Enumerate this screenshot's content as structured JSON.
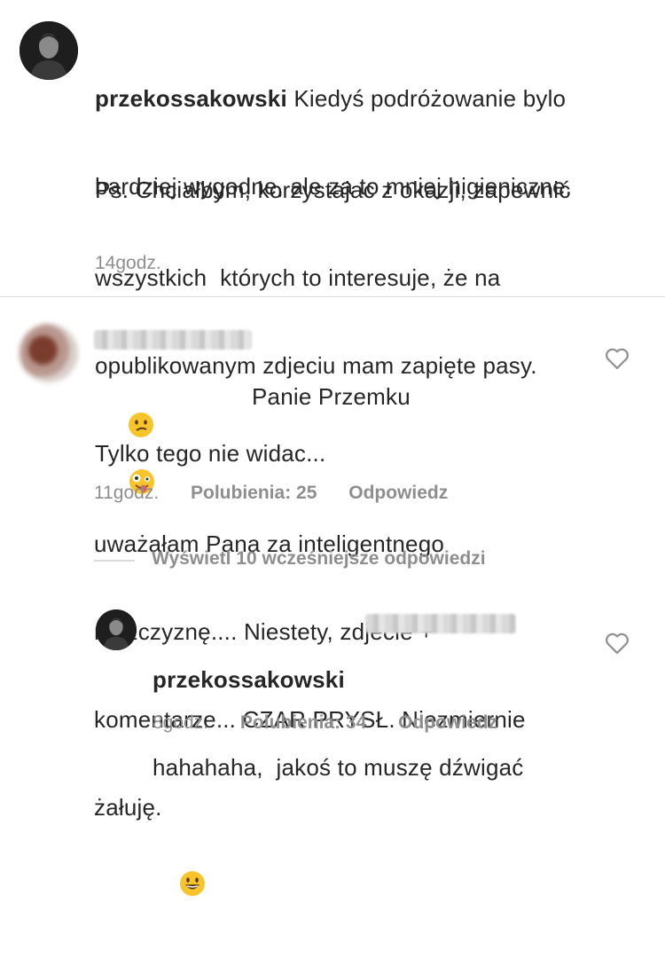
{
  "post": {
    "username": "przekossakowski",
    "caption_line1": "Kiedyś podróżowanie bylo",
    "caption_line2": "bardziej wygodne, ale za to mniej higieniczne.",
    "caption_ps_1": "Ps. Chciałbym, korzystajac z okazji, zapewnić",
    "caption_ps_2": "wszystkich  których to interesuje, że na",
    "caption_ps_3": "opublikowanym zdjeciu mam zapięte pasy.",
    "caption_ps_4": "Tylko tego nie widac...",
    "emoji": "zany-face-emoji",
    "time": "14godz."
  },
  "comment": {
    "line1": "Panie Przemku",
    "line1_emoji": "confused-face-emoji",
    "line2": "uważałam Pana za inteligentnego",
    "line3": "mężczyznę.... Niestety, zdjecie +",
    "line4": "komentarze... CZAR PRYSŁ. Niezmiernie",
    "line5": "żałuję.",
    "time": "11godz.",
    "likes": "Polubienia: 25",
    "reply": "Odpowiedz"
  },
  "view_replies": "Wyświetl 10 wcześniejsze odpowiedzi",
  "reply": {
    "username": "przekossakowski",
    "line1": "hahahaha,  jakoś to muszę dźwigać",
    "emoji": "grinning-face-emoji",
    "time": "8godz.",
    "likes": "Polubienia: 34",
    "reply": "Odpowiedz"
  },
  "colors": {
    "text": "#262626",
    "muted": "#8e8e8e",
    "divider": "#dbdbdb"
  }
}
